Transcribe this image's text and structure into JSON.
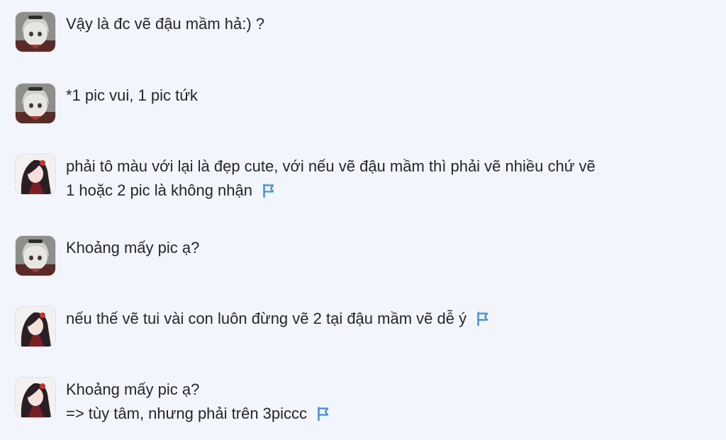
{
  "colors": {
    "background": "#f2f5fb",
    "text": "#262626",
    "flag": "#3b8de0"
  },
  "messages": [
    {
      "avatar": "girl-white-hair-avatar",
      "lines": [
        "Vậy là đc vẽ đậu mầm hả:) ?"
      ],
      "flag": false
    },
    {
      "avatar": "girl-white-hair-avatar",
      "lines": [
        "*1 pic vui, 1 pic tứk"
      ],
      "flag": false
    },
    {
      "avatar": "girl-dark-hair-avatar",
      "lines": [
        "phải tô màu với lại là đẹp cute, với nếu vẽ đậu mầm thì phải vẽ nhiều chứ vẽ",
        "1 hoặc 2 pic là không nhận"
      ],
      "flag": true
    },
    {
      "avatar": "girl-white-hair-avatar",
      "lines": [
        "Khoảng mấy pic ạ?"
      ],
      "flag": false
    },
    {
      "avatar": "girl-dark-hair-avatar",
      "lines": [
        "nếu thế vẽ tui vài con luôn đừng vẽ 2 tại đậu mầm vẽ dễ ý"
      ],
      "flag": true
    },
    {
      "avatar": "girl-dark-hair-avatar",
      "lines": [
        "Khoảng mấy pic ạ?",
        "=> tùy tâm, nhưng phải trên 3piccc"
      ],
      "flag": true
    }
  ]
}
